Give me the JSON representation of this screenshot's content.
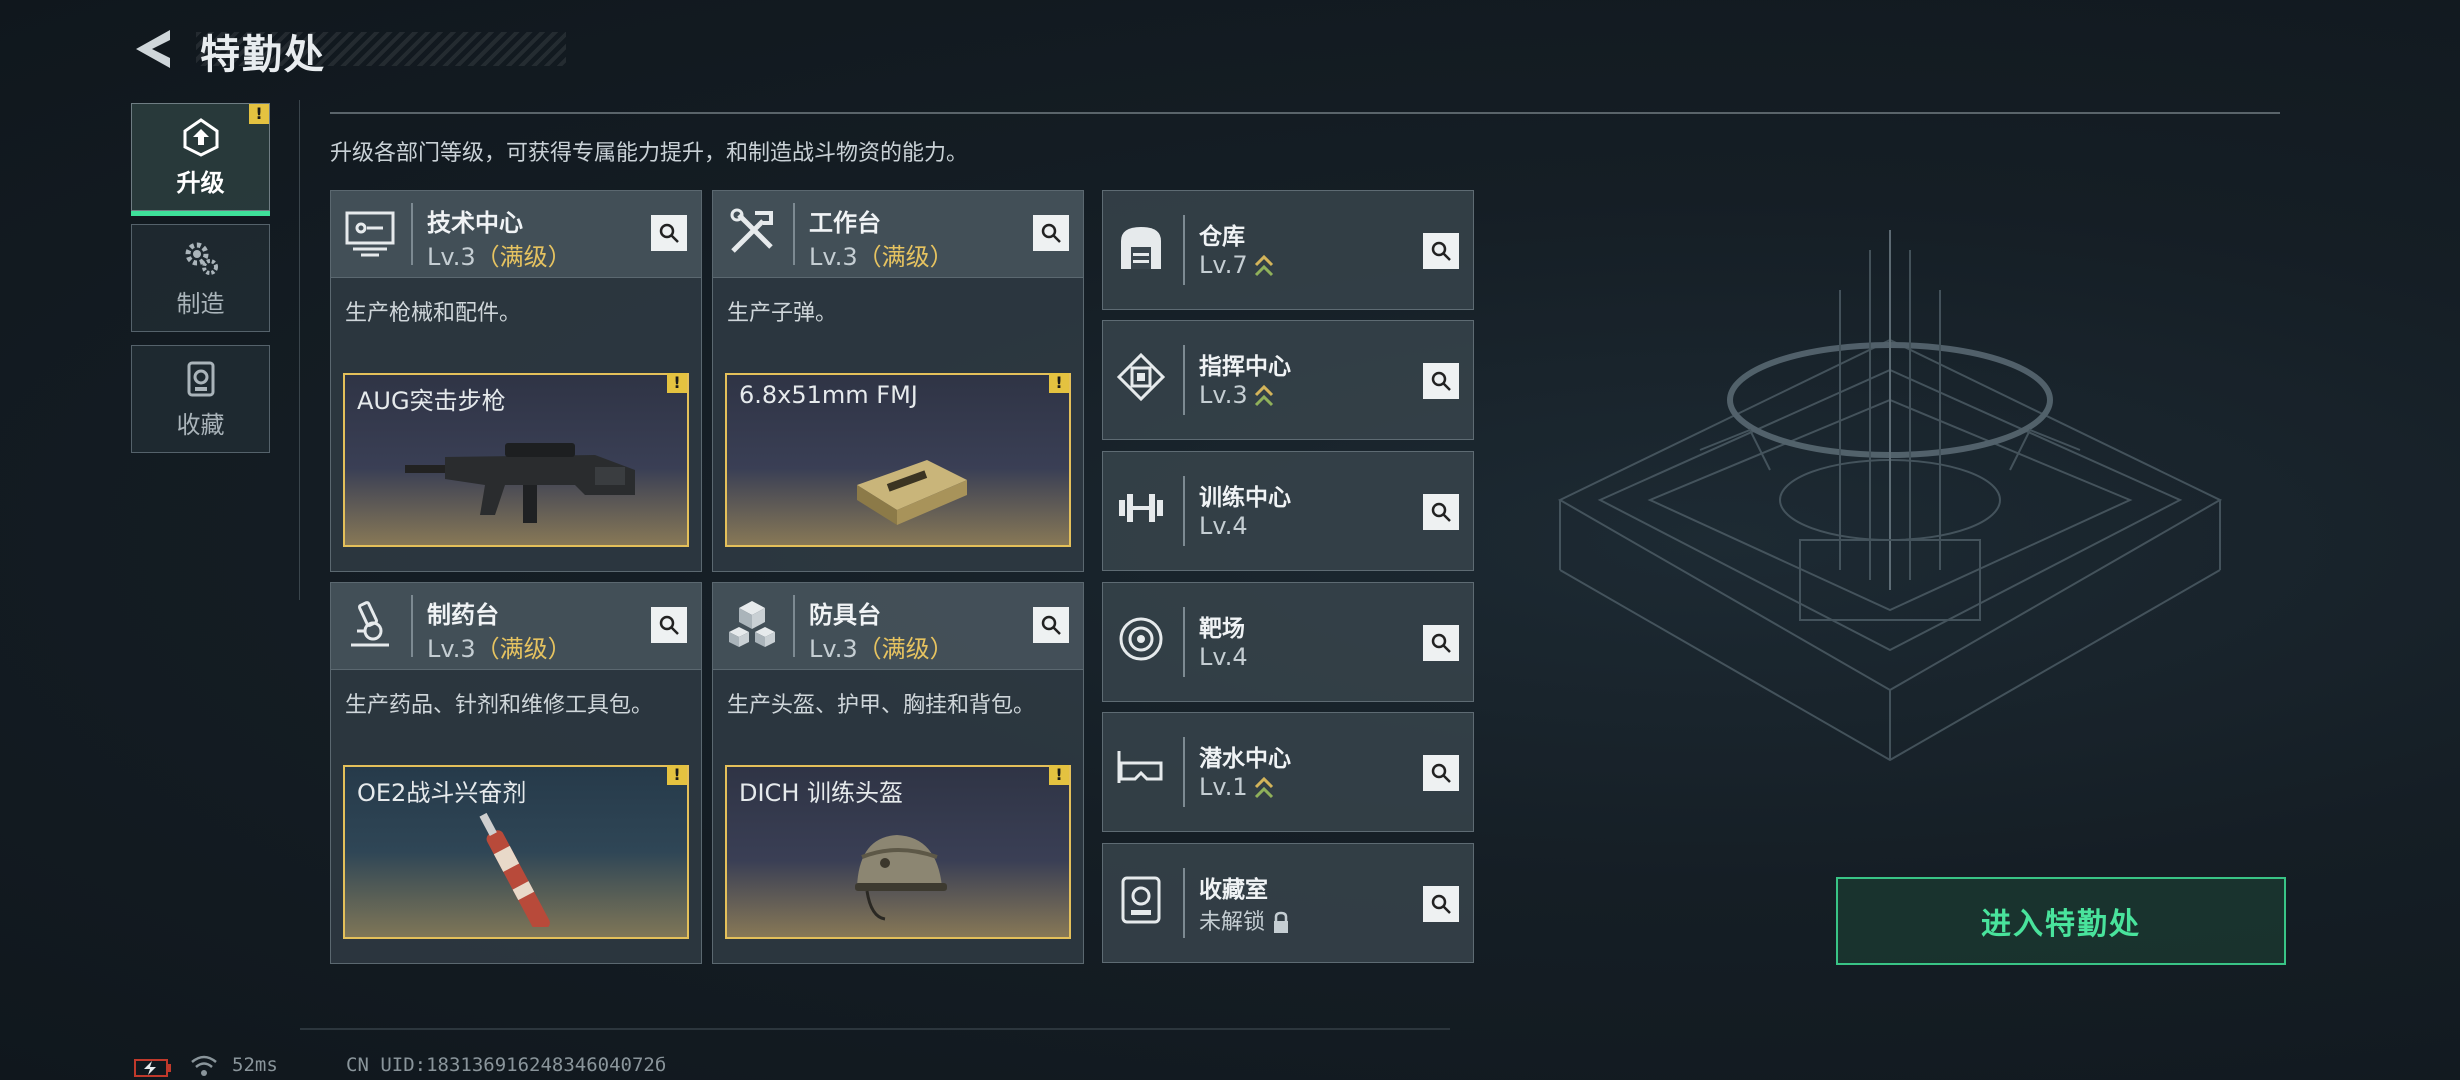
{
  "header": {
    "title": "特勤处"
  },
  "left_tabs": [
    {
      "label": "升级",
      "icon": "upgrade-icon",
      "active": true,
      "warn": "!"
    },
    {
      "label": "制造",
      "icon": "gears-icon",
      "active": false
    },
    {
      "label": "收藏",
      "icon": "collection-icon",
      "active": false
    }
  ],
  "description": "升级各部门等级，可获得专属能力提升，和制造战斗物资的能力。",
  "big_cards": [
    {
      "name": "技术中心",
      "level": "Lv.3",
      "max": "（满级）",
      "icon": "monitor-icon",
      "desc": "生产枪械和配件。",
      "product": "AUG突击步枪",
      "product_icon": "rifle-icon",
      "warn": "!"
    },
    {
      "name": "工作台",
      "level": "Lv.3",
      "max": "（满级）",
      "icon": "tools-icon",
      "desc": "生产子弹。",
      "product": "6.8x51mm FMJ",
      "product_icon": "ammo-box-icon",
      "warn": "!"
    },
    {
      "name": "制药台",
      "level": "Lv.3",
      "max": "（满级）",
      "icon": "microscope-icon",
      "desc": "生产药品、针剂和维修工具包。",
      "product": "OE2战斗兴奋剂",
      "product_icon": "syringe-icon",
      "warn": "!"
    },
    {
      "name": "防具台",
      "level": "Lv.3",
      "max": "（满级）",
      "icon": "cubes-icon",
      "desc": "生产头盔、护甲、胸挂和背包。",
      "product": "DICH 训练头盔",
      "product_icon": "helmet-icon",
      "warn": "!"
    }
  ],
  "small_cards": [
    {
      "name": "仓库",
      "level": "Lv.7",
      "icon": "warehouse-icon",
      "upgradable": true
    },
    {
      "name": "指挥中心",
      "level": "Lv.3",
      "icon": "chip-icon",
      "upgradable": true
    },
    {
      "name": "训练中心",
      "level": "Lv.4",
      "icon": "dumbbell-icon",
      "upgradable": false
    },
    {
      "name": "靶场",
      "level": "Lv.4",
      "icon": "target-icon",
      "upgradable": false
    },
    {
      "name": "潜水中心",
      "level": "Lv.1",
      "icon": "diving-mask-icon",
      "upgradable": true
    },
    {
      "name": "收藏室",
      "level": "未解锁",
      "icon": "vault-icon",
      "locked": true
    }
  ],
  "enter_button": "进入特勤处",
  "footer": {
    "ping": "52ms",
    "uid": "CN UID:18313691624834604072б"
  },
  "colors": {
    "accent_green": "#3fe09a",
    "gold": "#e6c360",
    "warn": "#e4c240"
  }
}
